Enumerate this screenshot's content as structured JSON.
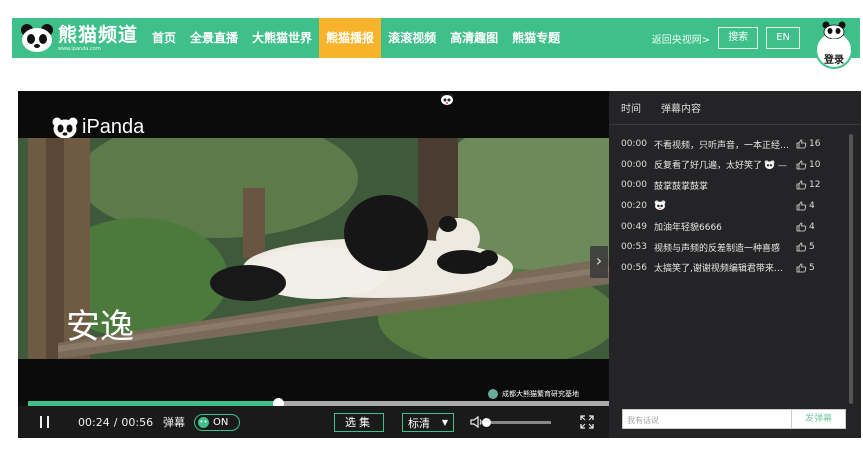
{
  "brand": {
    "name": "熊猫频道",
    "url": "www.ipanda.com",
    "accent_color": "#3fbf8a",
    "active_tab_color": "#f7b32b"
  },
  "nav": {
    "items": [
      {
        "label": "首页",
        "active": false
      },
      {
        "label": "全景直播",
        "active": false
      },
      {
        "label": "大熊猫世界",
        "active": false
      },
      {
        "label": "熊猫播报",
        "active": true
      },
      {
        "label": "滚滚视频",
        "active": false
      },
      {
        "label": "高清趣图",
        "active": false
      },
      {
        "label": "熊猫专题",
        "active": false
      }
    ],
    "back_link": "返回央视网>",
    "search_label": "搜索",
    "lang_label": "EN",
    "login_label": "登录"
  },
  "player": {
    "logo_text": "iPanda",
    "watermark": "成都大熊猫繁育研究基地",
    "caption": "安逸",
    "current_time": "00:24",
    "separator": "/",
    "duration": "00:56",
    "progress": 0.43,
    "danmu_label": "弹幕",
    "danmu_toggle": "ON",
    "episodes_label": "选集",
    "quality_label": "标清",
    "volume": 0.0
  },
  "danmaku": {
    "header_time": "时间",
    "header_content": "弹幕内容",
    "rows": [
      {
        "time": "00:00",
        "text": "不看视频，只听声音，一本正经…",
        "likes": "16"
      },
      {
        "time": "00:00",
        "text": "反复看了好几遍，太好笑了",
        "likes": "10"
      },
      {
        "time": "00:00",
        "text": "鼓掌鼓掌鼓掌",
        "likes": "12"
      },
      {
        "time": "00:20",
        "text": "",
        "likes": "4"
      },
      {
        "time": "00:49",
        "text": "加油年轻貌6666",
        "likes": "4"
      },
      {
        "time": "00:53",
        "text": "视频与声频的反差制造一种喜感",
        "likes": "5"
      },
      {
        "time": "00:56",
        "text": "太搞笑了,谢谢视频编辑君带来的…",
        "likes": "5"
      }
    ],
    "input_placeholder": "我有话说",
    "send_label": "发弹幕"
  }
}
